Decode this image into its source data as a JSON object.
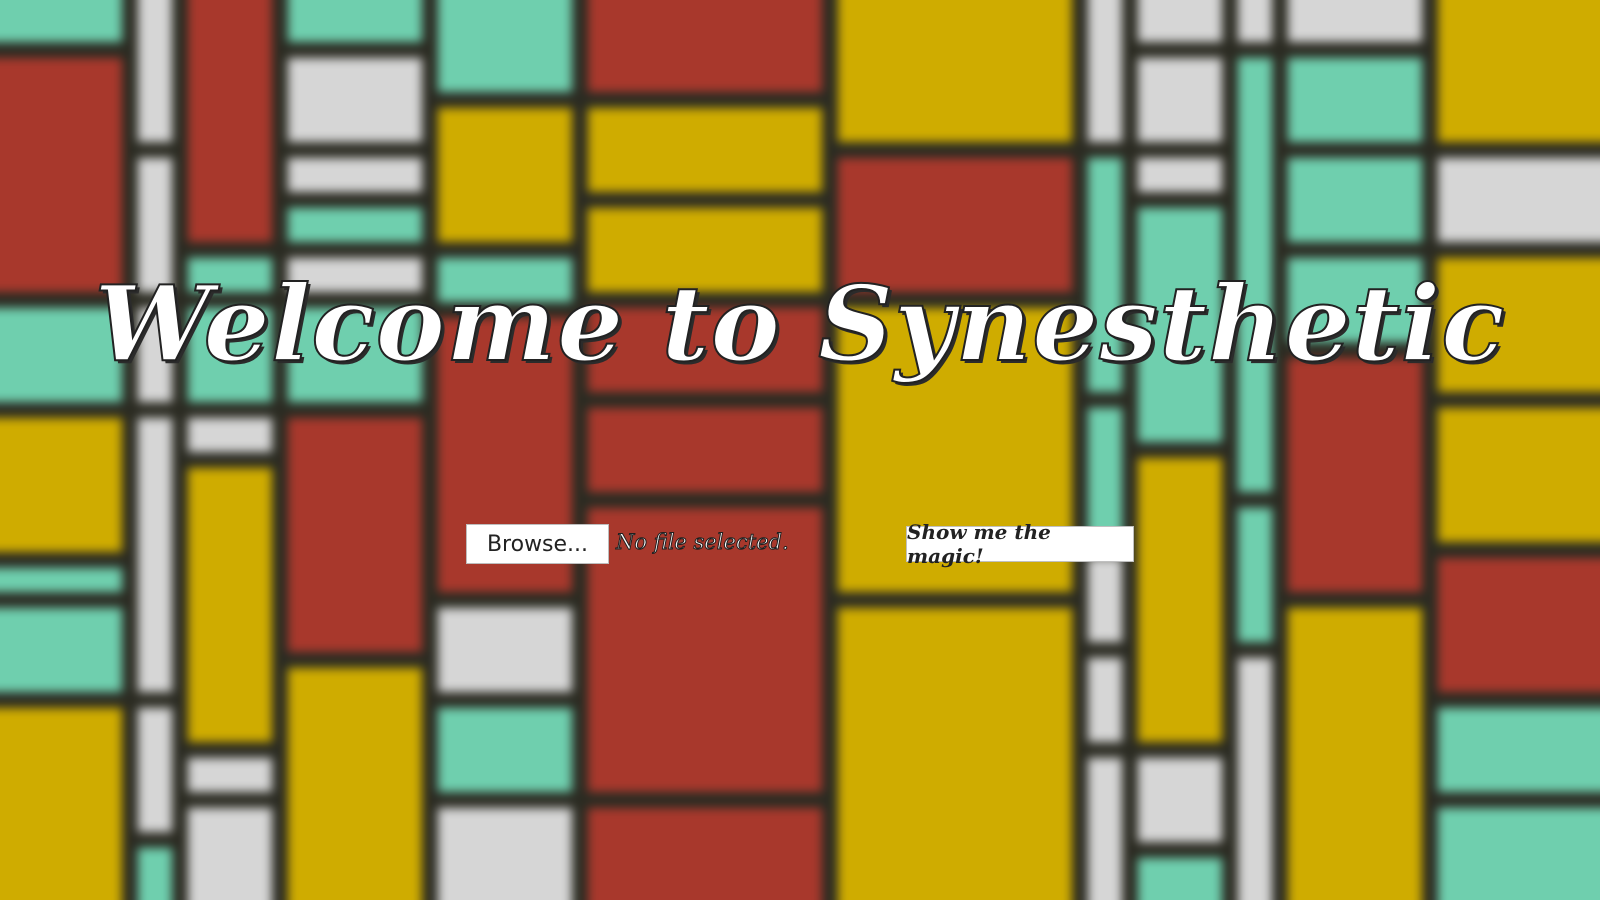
{
  "page": {
    "title": "Welcome to Synesthetic"
  },
  "upload": {
    "browse_label": "Browse...",
    "file_status": "No file selected."
  },
  "actions": {
    "submit_label": "Show me the magic!"
  },
  "background": {
    "description_colors": {
      "red": "#a8382c",
      "yellow": "#cfac00",
      "teal": "#6fcfae",
      "white": "#d6d6d6",
      "grid_lines": "#2b2b22"
    }
  }
}
